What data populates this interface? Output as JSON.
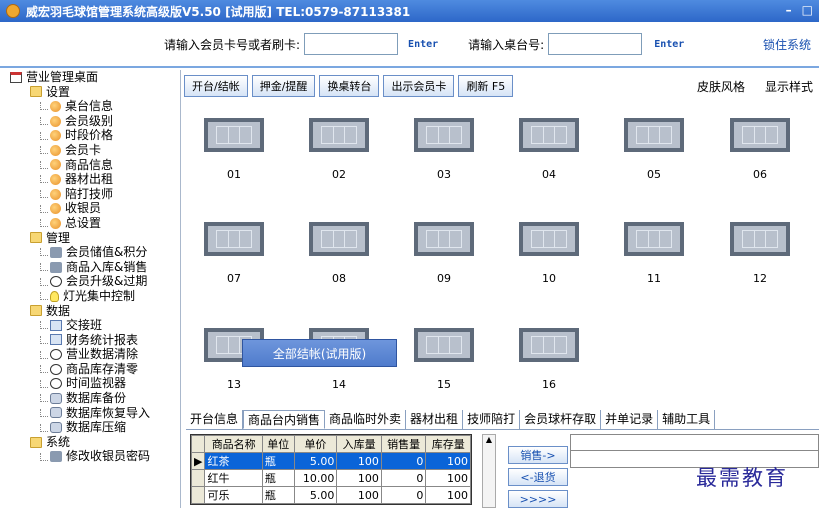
{
  "window": {
    "title": "威宏羽毛球馆管理系统高级版V5.50 [试用版]    TEL:0579-87113381",
    "min_glyph": "–",
    "max_glyph": "□",
    "close_glyph": "×"
  },
  "inputbar": {
    "card_label": "请输入会员卡号或者刷卡:",
    "card_value": "",
    "card_enter": "Enter",
    "table_label": "请输入桌台号:",
    "table_value": "",
    "table_enter": "Enter",
    "lock_label": "锁住系统"
  },
  "sidebar": {
    "root": "营业管理桌面",
    "groups": [
      {
        "label": "设置",
        "items": [
          "桌台信息",
          "会员级别",
          "时段价格",
          "会员卡",
          "商品信息",
          "器材出租",
          "陪打技师",
          "收银员",
          "总设置"
        ]
      },
      {
        "label": "管理",
        "items": [
          "会员储值&积分",
          "商品入库&销售",
          "会员升级&过期",
          "灯光集中控制"
        ]
      },
      {
        "label": "数据",
        "items": [
          "交接班",
          "财务统计报表",
          "营业数据清除",
          "商品库存清零",
          "时间监视器",
          "数据库备份",
          "数据库恢复导入",
          "数据库压缩"
        ]
      },
      {
        "label": "系统",
        "items": [
          "修改收银员密码"
        ]
      }
    ]
  },
  "toolbar": {
    "buttons": [
      "开台/结帐",
      "押金/提醒",
      "换桌转台",
      "出示会员卡",
      "刷新 F5"
    ],
    "skin": "皮肤风格",
    "display": "显示样式"
  },
  "tables": [
    "01",
    "02",
    "03",
    "04",
    "05",
    "06",
    "07",
    "08",
    "09",
    "10",
    "11",
    "12",
    "13",
    "14",
    "15",
    "16"
  ],
  "popup": {
    "label": "全部结帐(试用版)"
  },
  "bottom": {
    "tabs": [
      "开台信息",
      "商品台内销售",
      "商品临时外卖",
      "器材出租",
      "技师陪打",
      "会员球杆存取",
      "并单记录",
      "辅助工具"
    ],
    "active_tab": "商品台内销售",
    "columns": [
      "商品名称",
      "单位",
      "单价",
      "入库量",
      "销售量",
      "库存量"
    ],
    "rows": [
      {
        "name": "红茶",
        "unit": "瓶",
        "price": "5.00",
        "in": "100",
        "sold": "0",
        "stock": "100",
        "selected": true
      },
      {
        "name": "红牛",
        "unit": "瓶",
        "price": "10.00",
        "in": "100",
        "sold": "0",
        "stock": "100",
        "selected": false
      },
      {
        "name": "可乐",
        "unit": "瓶",
        "price": "5.00",
        "in": "100",
        "sold": "0",
        "stock": "100",
        "selected": false
      }
    ],
    "sell_button": "销售->",
    "return_button": "<-退货",
    "more_button": ">>>>"
  },
  "watermark": "最需教育",
  "colors": {
    "titlebar": "#2d67c8",
    "selection": "#0a64d8",
    "accent_link": "#1850b0"
  }
}
